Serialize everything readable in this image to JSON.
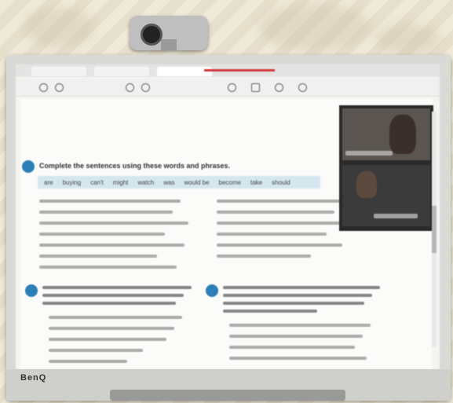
{
  "scene": {
    "monitor_brand": "BenQ",
    "worksheet": {
      "instruction_1": "Complete the sentences using these words and phrases.",
      "word_bank": [
        "are",
        "buying",
        "can't",
        "might",
        "watch",
        "was",
        "would be",
        "become",
        "take",
        "should"
      ]
    }
  },
  "colors": {
    "accent": "#2d7fb8",
    "tab_highlight": "#d23a3a"
  },
  "icons": [
    "webcam-icon",
    "pencil-icon",
    "undo-icon",
    "search-icon"
  ]
}
